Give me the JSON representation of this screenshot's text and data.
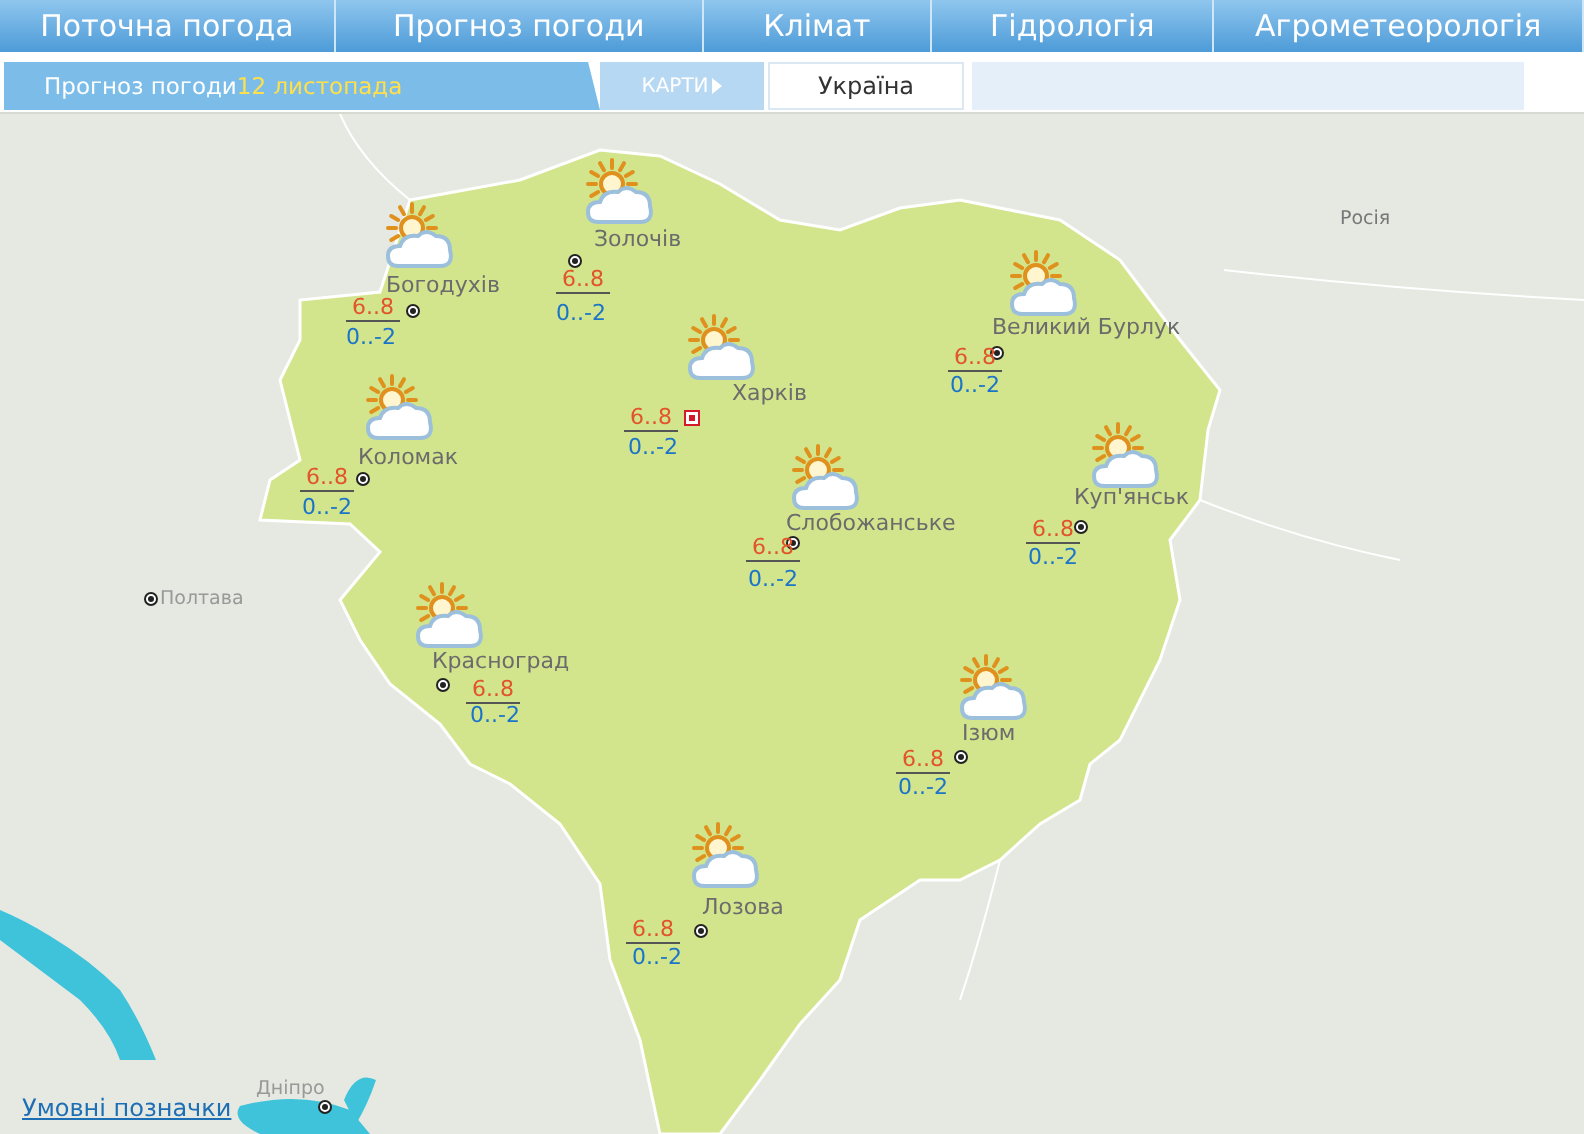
{
  "nav": [
    "Поточна погода",
    "Прогноз погоди",
    "Клімат",
    "Гідрологія",
    "Агрометеорологія"
  ],
  "subbar": {
    "title": "Прогноз погоди",
    "date": "12 листопада",
    "maps_button": "КАРТИ",
    "region_tab": "Україна"
  },
  "map": {
    "stations": [
      {
        "name": "Богодухів",
        "day": "6..8",
        "night": "0..-2",
        "kind": "town"
      },
      {
        "name": "Золочів",
        "day": "6..8",
        "night": "0..-2",
        "kind": "town"
      },
      {
        "name": "Харків",
        "day": "6..8",
        "night": "0..-2",
        "kind": "capital"
      },
      {
        "name": "Коломак",
        "day": "6..8",
        "night": "0..-2",
        "kind": "town"
      },
      {
        "name": "Великий Бурлук",
        "day": "6..8",
        "night": "0..-2",
        "kind": "town"
      },
      {
        "name": "Слобожанське",
        "day": "6..8",
        "night": "0..-2",
        "kind": "town"
      },
      {
        "name": "Куп'янськ",
        "day": "6..8",
        "night": "0..-2",
        "kind": "town"
      },
      {
        "name": "Красноград",
        "day": "6..8",
        "night": "0..-2",
        "kind": "town"
      },
      {
        "name": "Ізюм",
        "day": "6..8",
        "night": "0..-2",
        "kind": "town"
      },
      {
        "name": "Лозова",
        "day": "6..8",
        "night": "0..-2",
        "kind": "town"
      }
    ],
    "places": [
      {
        "name": "Полтава",
        "kind": "city"
      },
      {
        "name": "Росія",
        "kind": "country"
      },
      {
        "name": "Дніпро",
        "kind": "city"
      }
    ],
    "legend_link": "Умовні позначки"
  }
}
